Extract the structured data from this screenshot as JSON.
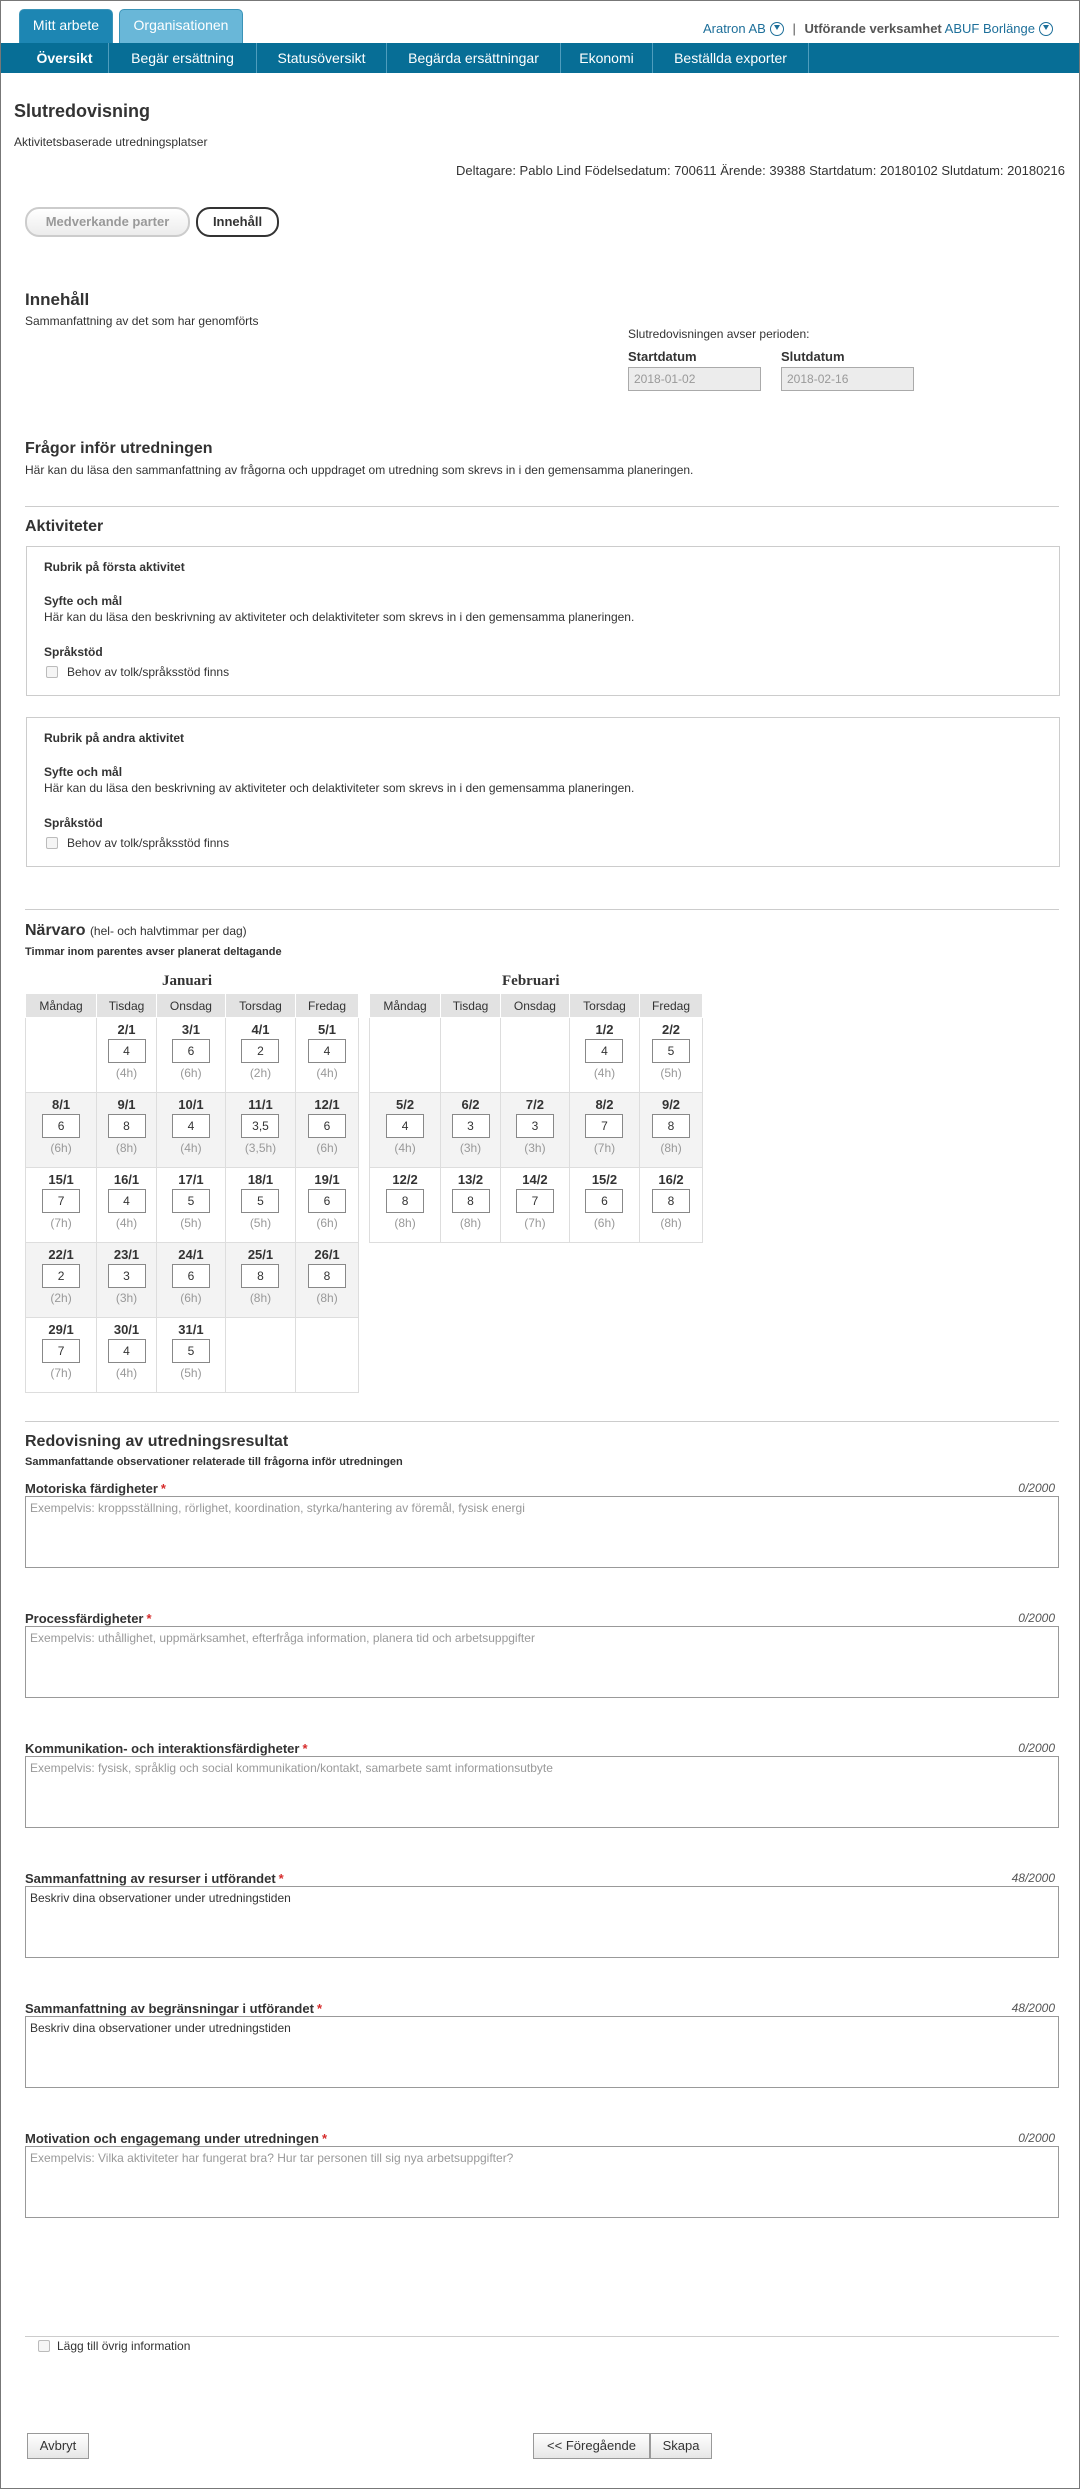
{
  "topbar": {
    "tabs": [
      "Mitt arbete",
      "Organisationen"
    ],
    "org": "Aratron AB",
    "unit_label": "Utförande verksamhet",
    "unit_value": "ABUF Borlänge"
  },
  "nav": [
    "Översikt",
    "Begär ersättning",
    "Statusöversikt",
    "Begärda ersättningar",
    "Ekonomi",
    "Beställda exporter"
  ],
  "page": {
    "title": "Slutredovisning",
    "subtitle": "Aktivitetsbaserade utredningsplatser",
    "participant": "Deltagare: Pablo Lind Födelsedatum: 700611 Ärende: 39388 Startdatum: 20180102 Slutdatum: 20180216"
  },
  "steps": [
    "Medverkande parter",
    "Innehåll"
  ],
  "content": {
    "heading": "Innehåll",
    "desc": "Sammanfattning av det som har genomförts",
    "period_label": "Slutredovisningen avser perioden:",
    "start_label": "Startdatum",
    "start_value": "2018-01-02",
    "end_label": "Slutdatum",
    "end_value": "2018-02-16"
  },
  "questions": {
    "heading": "Frågor inför utredningen",
    "desc": "Här kan du läsa den sammanfattning av frågorna och uppdraget om utredning som skrevs in i den gemensamma planeringen."
  },
  "activities": {
    "heading": "Aktiviteter",
    "items": [
      {
        "title": "Rubrik på första aktivitet",
        "purpose_label": "Syfte och mål",
        "purpose_text": "Här kan du läsa den beskrivning av aktiviteter och delaktiviteter som skrevs in i den gemensamma planeringen.",
        "lang_label": "Språkstöd",
        "lang_checkbox": "Behov av tolk/språksstöd finns"
      },
      {
        "title": "Rubrik på andra aktivitet",
        "purpose_label": "Syfte och mål",
        "purpose_text": "Här kan du läsa den beskrivning av aktiviteter och delaktiviteter som skrevs in i den gemensamma planeringen.",
        "lang_label": "Språkstöd",
        "lang_checkbox": "Behov av tolk/språksstöd finns"
      }
    ]
  },
  "attendance": {
    "heading": "Närvaro",
    "heading_note": "(hel- och halvtimmar per dag)",
    "desc": "Timmar inom parentes avser planerat deltagande",
    "weekdays": [
      "Måndag",
      "Tisdag",
      "Onsdag",
      "Torsdag",
      "Fredag"
    ],
    "months": [
      {
        "name": "Januari",
        "weeks": [
          [
            null,
            {
              "d": "2/1",
              "h": "4",
              "p": "(4h)"
            },
            {
              "d": "3/1",
              "h": "6",
              "p": "(6h)"
            },
            {
              "d": "4/1",
              "h": "2",
              "p": "(2h)"
            },
            {
              "d": "5/1",
              "h": "4",
              "p": "(4h)"
            }
          ],
          [
            {
              "d": "8/1",
              "h": "6",
              "p": "(6h)"
            },
            {
              "d": "9/1",
              "h": "8",
              "p": "(8h)"
            },
            {
              "d": "10/1",
              "h": "4",
              "p": "(4h)"
            },
            {
              "d": "11/1",
              "h": "3,5",
              "p": "(3,5h)"
            },
            {
              "d": "12/1",
              "h": "6",
              "p": "(6h)"
            }
          ],
          [
            {
              "d": "15/1",
              "h": "7",
              "p": "(7h)"
            },
            {
              "d": "16/1",
              "h": "4",
              "p": "(4h)"
            },
            {
              "d": "17/1",
              "h": "5",
              "p": "(5h)"
            },
            {
              "d": "18/1",
              "h": "5",
              "p": "(5h)"
            },
            {
              "d": "19/1",
              "h": "6",
              "p": "(6h)"
            }
          ],
          [
            {
              "d": "22/1",
              "h": "2",
              "p": "(2h)"
            },
            {
              "d": "23/1",
              "h": "3",
              "p": "(3h)"
            },
            {
              "d": "24/1",
              "h": "6",
              "p": "(6h)"
            },
            {
              "d": "25/1",
              "h": "8",
              "p": "(8h)"
            },
            {
              "d": "26/1",
              "h": "8",
              "p": "(8h)"
            }
          ],
          [
            {
              "d": "29/1",
              "h": "7",
              "p": "(7h)"
            },
            {
              "d": "30/1",
              "h": "4",
              "p": "(4h)"
            },
            {
              "d": "31/1",
              "h": "5",
              "p": "(5h)"
            },
            null,
            null
          ]
        ]
      },
      {
        "name": "Februari",
        "weeks": [
          [
            null,
            null,
            null,
            {
              "d": "1/2",
              "h": "4",
              "p": "(4h)"
            },
            {
              "d": "2/2",
              "h": "5",
              "p": "(5h)"
            }
          ],
          [
            {
              "d": "5/2",
              "h": "4",
              "p": "(4h)"
            },
            {
              "d": "6/2",
              "h": "3",
              "p": "(3h)"
            },
            {
              "d": "7/2",
              "h": "3",
              "p": "(3h)"
            },
            {
              "d": "8/2",
              "h": "7",
              "p": "(7h)"
            },
            {
              "d": "9/2",
              "h": "8",
              "p": "(8h)"
            }
          ],
          [
            {
              "d": "12/2",
              "h": "8",
              "p": "(8h)"
            },
            {
              "d": "13/2",
              "h": "8",
              "p": "(8h)"
            },
            {
              "d": "14/2",
              "h": "7",
              "p": "(7h)"
            },
            {
              "d": "15/2",
              "h": "6",
              "p": "(6h)"
            },
            {
              "d": "16/2",
              "h": "8",
              "p": "(8h)"
            }
          ]
        ]
      }
    ]
  },
  "results": {
    "heading": "Redovisning av utredningsresultat",
    "desc": "Sammanfattande observationer relaterade till frågorna inför utredningen",
    "fields": [
      {
        "label": "Motoriska färdigheter",
        "count": "0/2000",
        "value": "",
        "placeholder": "Exempelvis: kroppsställning, rörlighet, koordination, styrka/hantering av föremål, fysisk energi"
      },
      {
        "label": "Processfärdigheter",
        "count": "0/2000",
        "value": "",
        "placeholder": "Exempelvis: uthållighet, uppmärksamhet, efterfråga information, planera tid och arbetsuppgifter"
      },
      {
        "label": "Kommunikation- och interaktionsfärdigheter",
        "count": "0/2000",
        "value": "",
        "placeholder": "Exempelvis: fysisk, språklig och social kommunikation/kontakt, samarbete samt informationsutbyte"
      },
      {
        "label": "Sammanfattning av resurser i utförandet",
        "count": "48/2000",
        "value": "Beskriv dina observationer under utredningstiden",
        "placeholder": ""
      },
      {
        "label": "Sammanfattning av begränsningar i utförandet",
        "count": "48/2000",
        "value": "Beskriv dina observationer under utredningstiden",
        "placeholder": ""
      },
      {
        "label": "Motivation och engagemang under utredningen",
        "count": "0/2000",
        "value": "",
        "placeholder": "Exempelvis: Vilka aktiviteter har fungerat bra? Hur tar personen till sig nya arbetsuppgifter?"
      }
    ]
  },
  "extra_info_label": "Lägg till övrig information",
  "buttons": {
    "cancel": "Avbryt",
    "previous": "<< Föregående",
    "create": "Skapa"
  }
}
